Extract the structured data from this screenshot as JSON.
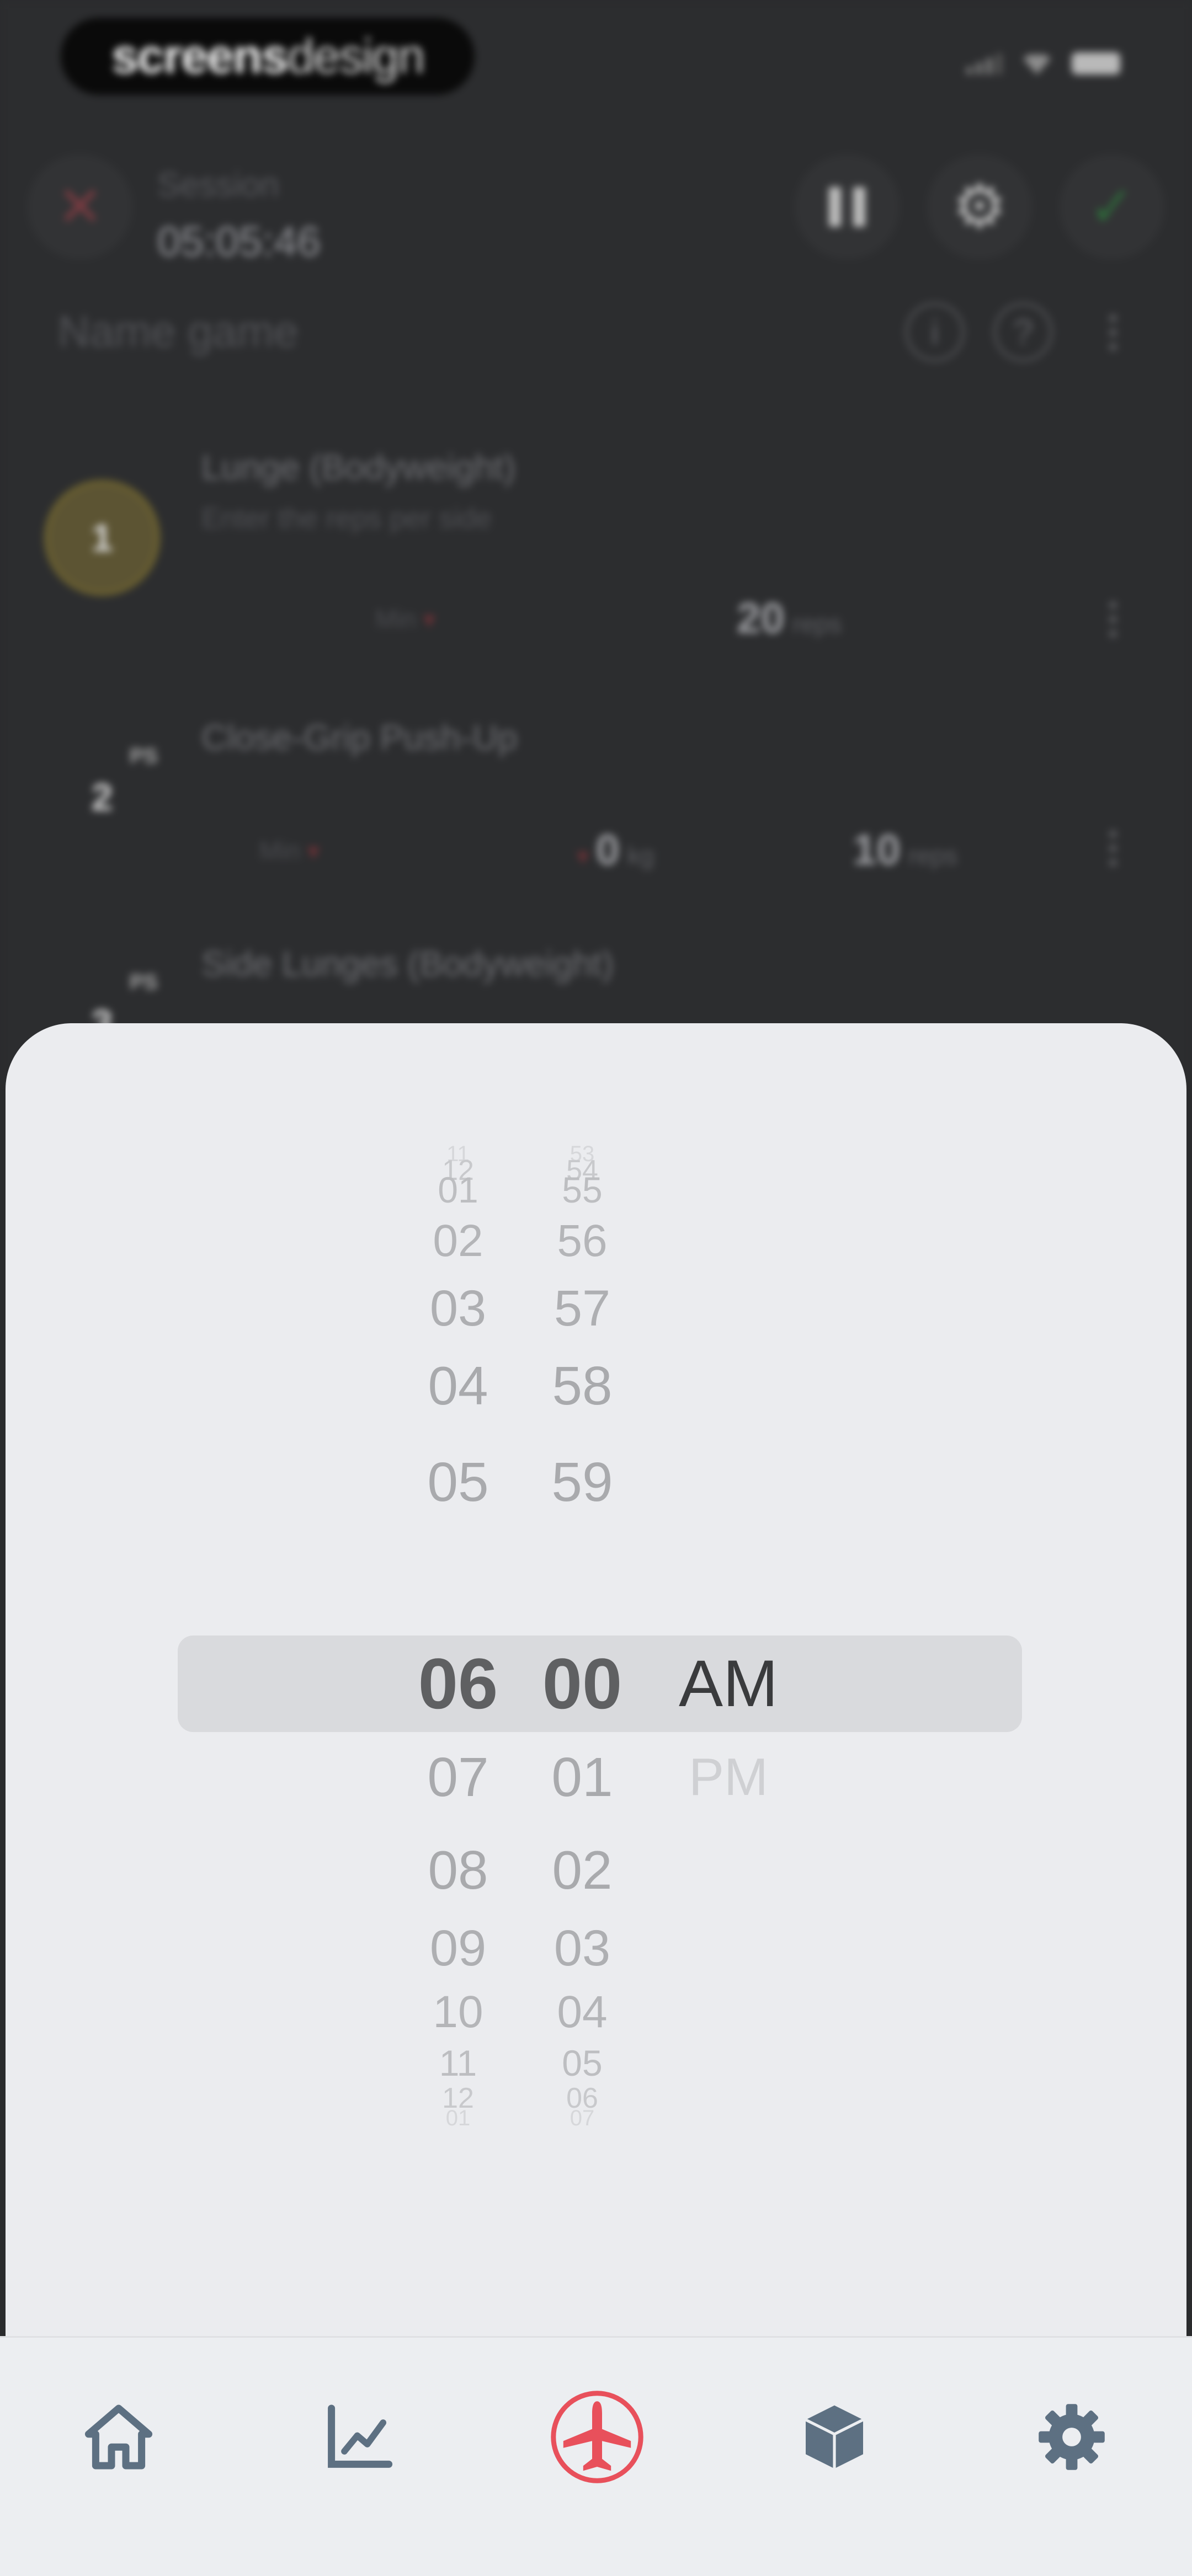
{
  "watermark": {
    "strong": "screens",
    "light": "design"
  },
  "workout": {
    "label": "Session",
    "timer": "05:05:46"
  },
  "name_prompt": "Name game",
  "info_glyph": "i",
  "help_glyph": "?",
  "exercises": [
    {
      "number": "1",
      "name": "Lunge (Bodyweight)",
      "sub": "Enter the reps per side",
      "reps_label": "Min",
      "reps_value": "20",
      "reps_unit": "reps"
    },
    {
      "number": "2",
      "name": "Close-Grip Push-Up",
      "tag": "PS",
      "min_label": "Min",
      "weight_value": "0",
      "weight_unit": "kg",
      "reps_value": "10",
      "reps_unit": "reps"
    },
    {
      "number": "3",
      "name": "Side Lunges (Bodyweight)",
      "tag": "PS"
    }
  ],
  "time_picker": {
    "hours": [
      "11",
      "12",
      "01",
      "02",
      "03",
      "04",
      "05",
      "06",
      "07",
      "08",
      "09",
      "10",
      "11",
      "12",
      "01"
    ],
    "minutes": [
      "53",
      "54",
      "55",
      "56",
      "57",
      "58",
      "59",
      "00",
      "01",
      "02",
      "03",
      "04",
      "05",
      "06",
      "07"
    ],
    "periods": [
      "AM",
      "PM"
    ],
    "selected_hour": "06",
    "selected_minute": "00",
    "selected_period": "AM"
  },
  "colors": {
    "accent_red": "#e8505b",
    "icon_slate": "#5d7082",
    "sheet_bg": "#ebecef",
    "selection_band": "#d9dadd"
  },
  "tabs": [
    {
      "id": "home",
      "icon": "home-icon"
    },
    {
      "id": "progress",
      "icon": "chart-icon"
    },
    {
      "id": "workout",
      "icon": "airplane-icon",
      "active": true
    },
    {
      "id": "library",
      "icon": "cube-icon"
    },
    {
      "id": "settings",
      "icon": "gear-icon"
    }
  ]
}
